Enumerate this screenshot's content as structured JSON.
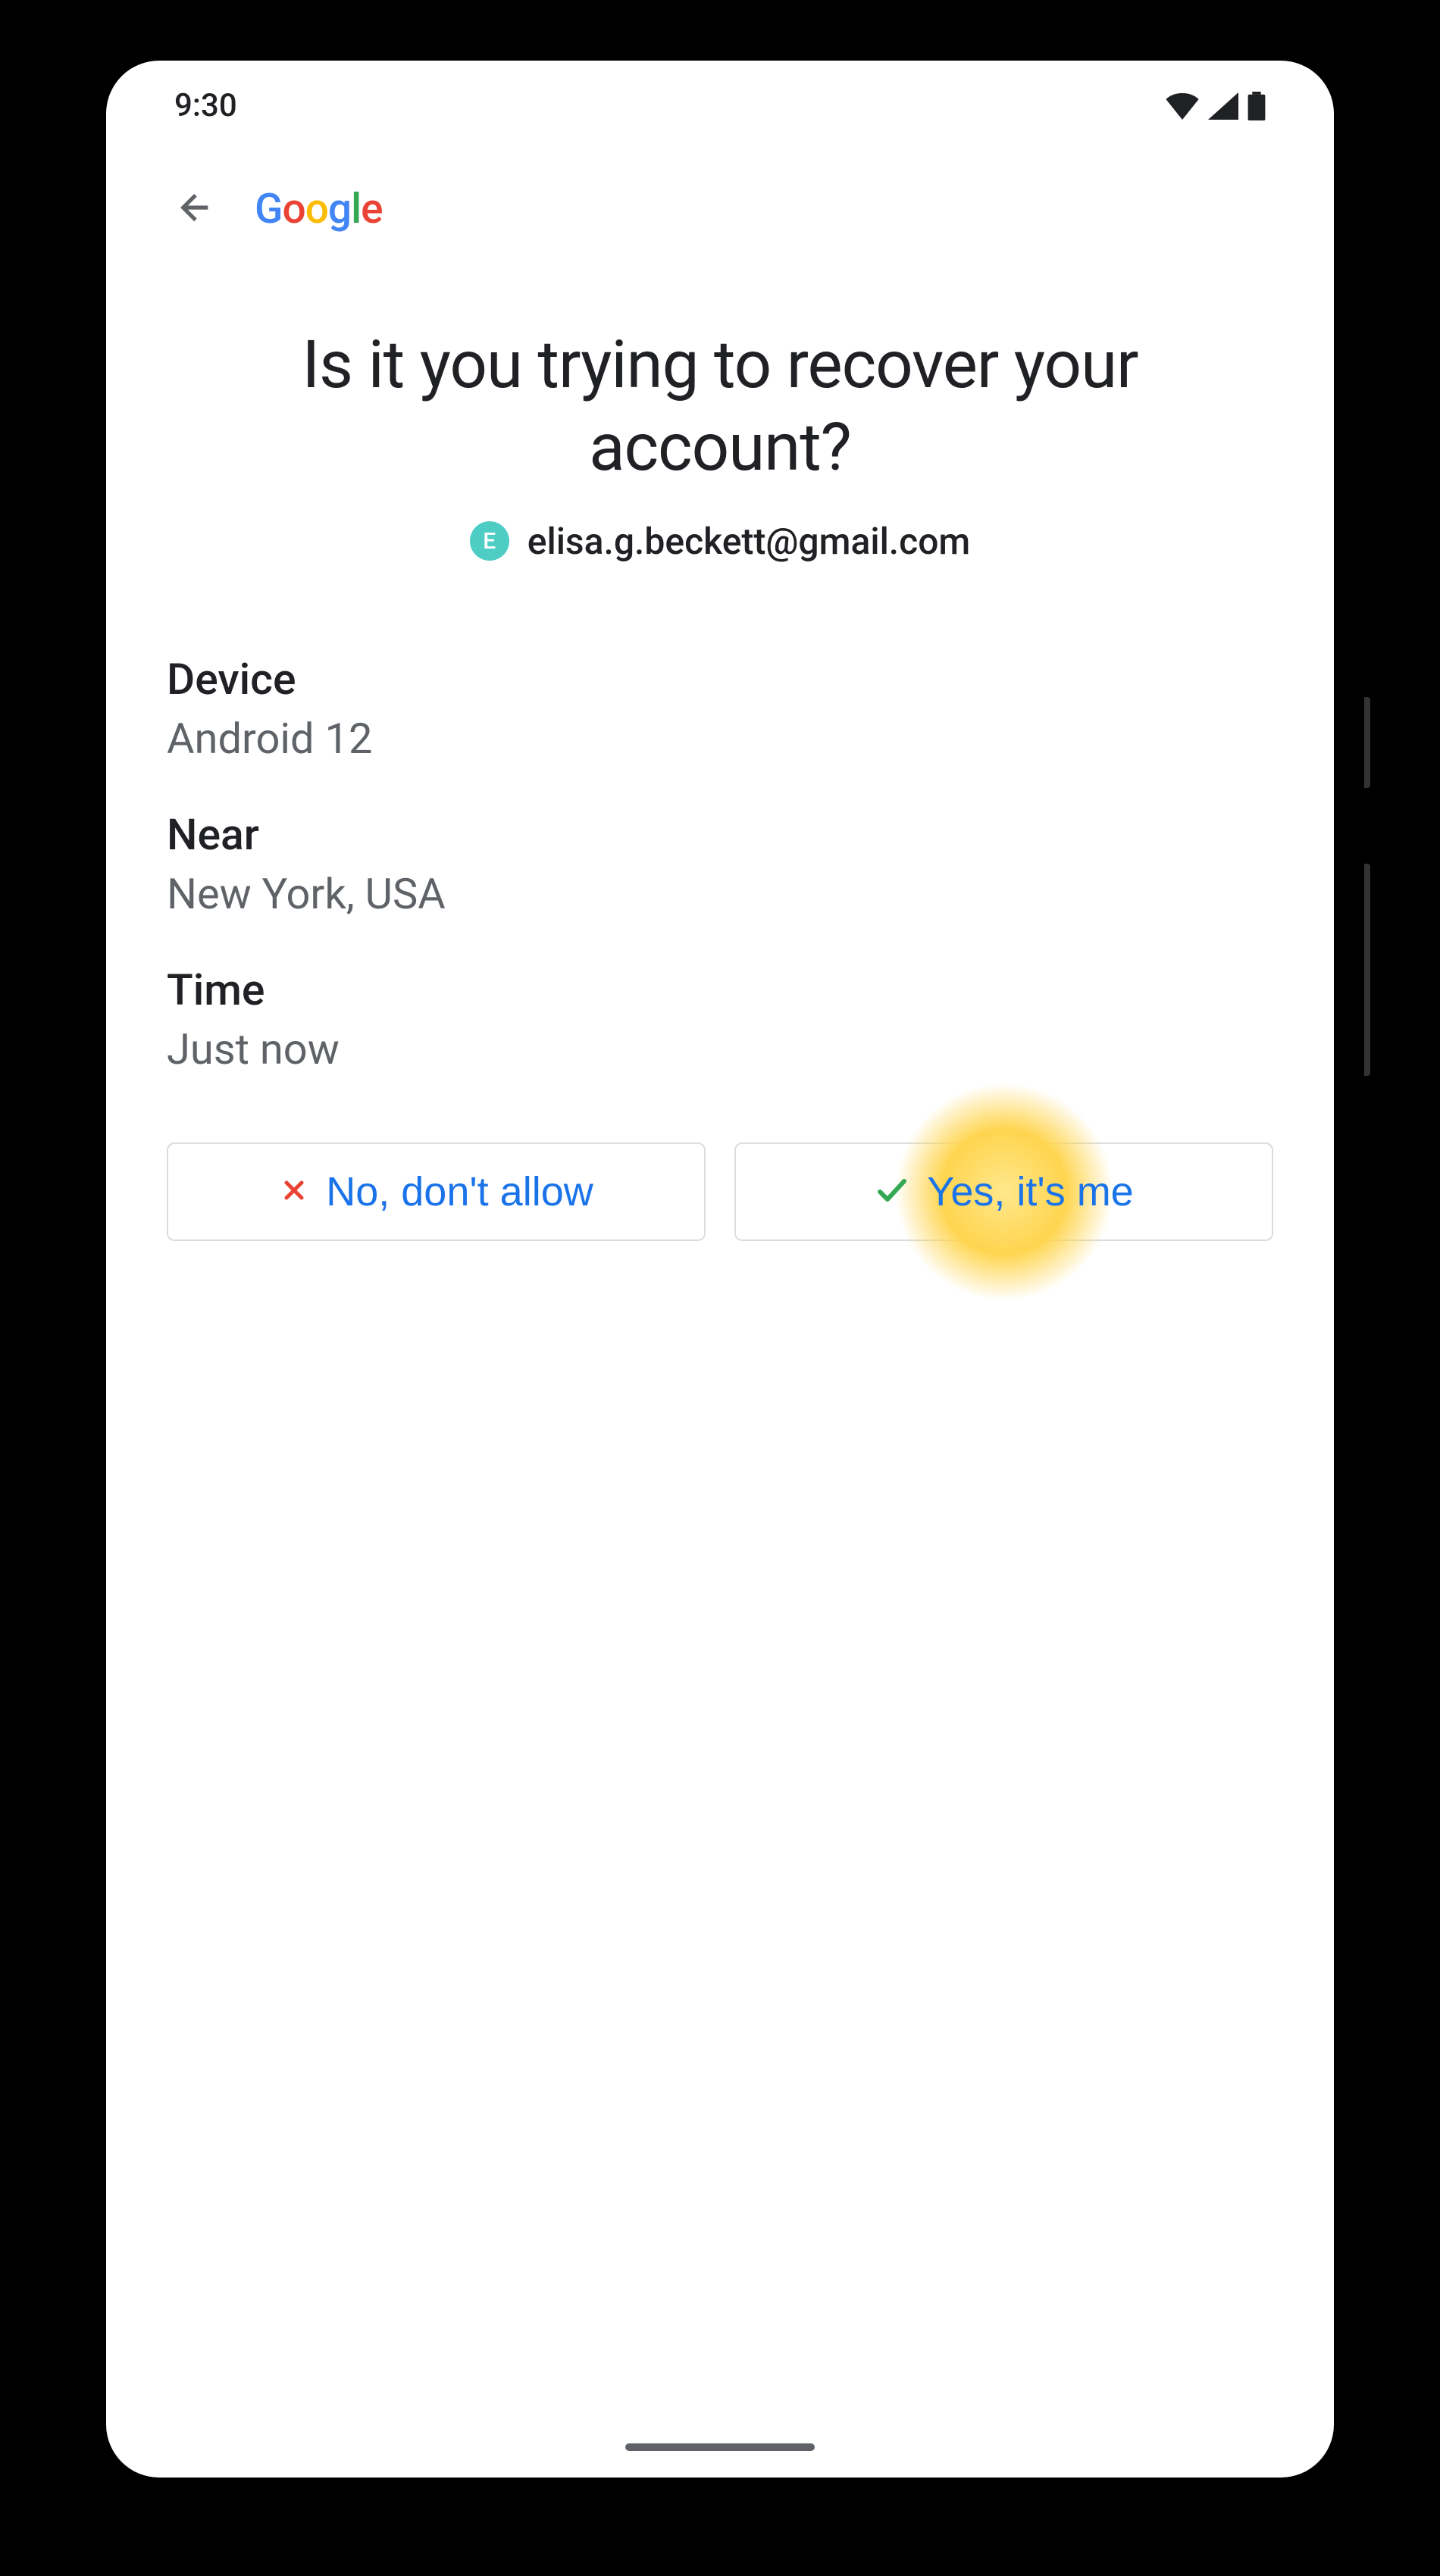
{
  "status": {
    "time": "9:30"
  },
  "header": {
    "logo_text": "Google"
  },
  "main": {
    "title": "Is it you trying to recover your account?",
    "account": {
      "avatar_initial": "E",
      "email": "elisa.g.beckett@gmail.com"
    },
    "details": [
      {
        "label": "Device",
        "value": "Android 12"
      },
      {
        "label": "Near",
        "value": "New York, USA"
      },
      {
        "label": "Time",
        "value": "Just now"
      }
    ],
    "buttons": {
      "deny": "No, don't allow",
      "allow": "Yes, it's me"
    }
  },
  "colors": {
    "accent_blue": "#1a73e8",
    "text_primary": "#202124",
    "text_secondary": "#5f6368",
    "avatar_bg": "#4ECDC4",
    "highlight": "#FFD54F",
    "deny_icon": "#EA4335",
    "allow_icon": "#34A853"
  }
}
